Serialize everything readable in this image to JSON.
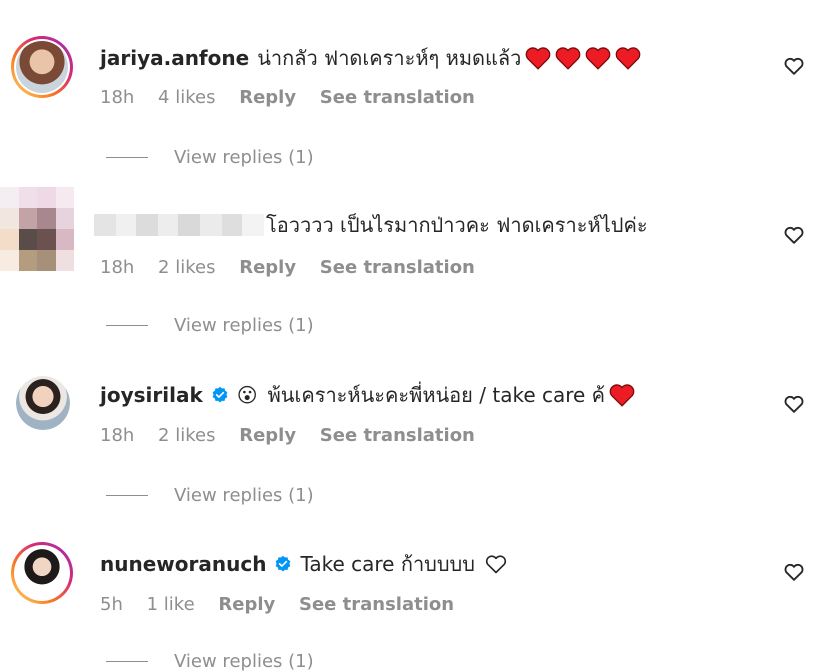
{
  "colors": {
    "text": "#262626",
    "muted": "#8e8e8e",
    "heart": "#ed1c24",
    "verified": "#0095f6"
  },
  "comments": [
    {
      "username": "jariya.anfone",
      "text": "น่ากลัว ฟาดเคราะห์ๆ หมดแล้ว",
      "time": "18h",
      "likes": "4 likes",
      "reply": "Reply",
      "translation": "See translation",
      "view_replies": "View replies (1)"
    },
    {
      "username": "",
      "text": "โอวววว เป็นไรมากป่าวคะ ฟาดเคราะห์ไปค่ะ",
      "time": "18h",
      "likes": "2 likes",
      "reply": "Reply",
      "translation": "See translation",
      "view_replies": "View replies (1)"
    },
    {
      "username": "joysirilak",
      "emoji": "😮",
      "text": "พ้นเคราะห์นะคะพี่หน่อย / take care ค้ ",
      "time": "18h",
      "likes": "2 likes",
      "reply": "Reply",
      "translation": "See translation",
      "view_replies": "View replies (1)"
    },
    {
      "username": "nuneworanuch",
      "text": "Take care ก้าบบบบ",
      "time": "5h",
      "likes": "1 like",
      "reply": "Reply",
      "translation": "See translation",
      "view_replies": "View replies (1)"
    }
  ]
}
